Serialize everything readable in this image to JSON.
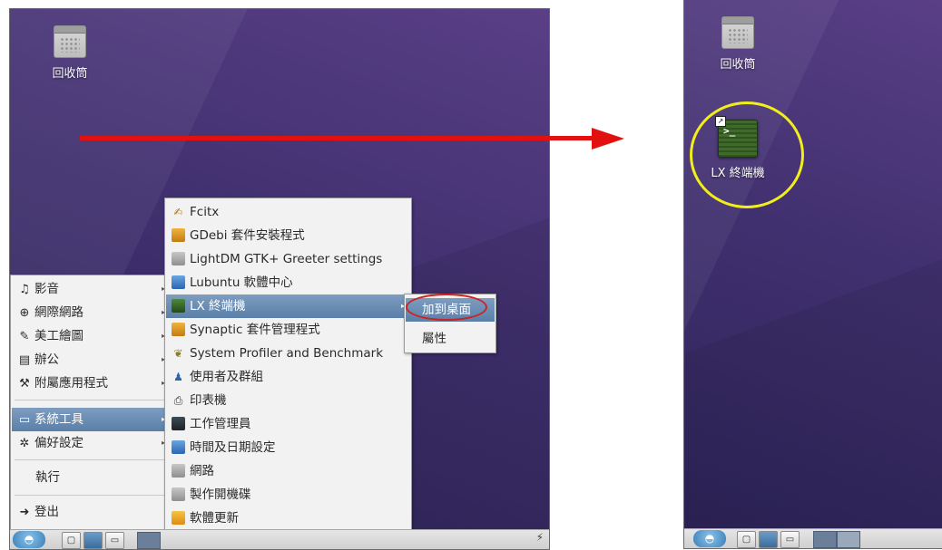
{
  "left_desktop": {
    "trash_label": "回收筒"
  },
  "right_desktop": {
    "trash_label": "回收筒",
    "terminal_label": "LX 終端機",
    "terminal_prompt": ">_"
  },
  "main_menu": {
    "items": [
      {
        "icon": "multimedia-icon",
        "label": "影音"
      },
      {
        "icon": "globe-icon",
        "label": "網際網路"
      },
      {
        "icon": "graphics-icon",
        "label": "美工繪圖"
      },
      {
        "icon": "office-icon",
        "label": "辦公"
      },
      {
        "icon": "accessories-icon",
        "label": "附屬應用程式"
      },
      {
        "icon": "monitor-icon",
        "label": "系統工具"
      },
      {
        "icon": "gear-icon",
        "label": "偏好設定"
      },
      {
        "icon": "",
        "label": "執行"
      },
      {
        "icon": "logout-icon",
        "label": "登出"
      }
    ],
    "selected": "系統工具"
  },
  "system_tools_menu": {
    "items": [
      {
        "icon": "fcitx-icon",
        "label": "Fcitx"
      },
      {
        "icon": "package-icon",
        "label": "GDebi 套件安裝程式"
      },
      {
        "icon": "settings-window-icon",
        "label": "LightDM GTK+ Greeter settings"
      },
      {
        "icon": "software-center-icon",
        "label": "Lubuntu 軟體中心"
      },
      {
        "icon": "terminal-icon",
        "label": "LX 終端機"
      },
      {
        "icon": "synaptic-icon",
        "label": "Synaptic 套件管理程式"
      },
      {
        "icon": "profiler-icon",
        "label": "System Profiler and Benchmark"
      },
      {
        "icon": "users-icon",
        "label": "使用者及群組"
      },
      {
        "icon": "printer-icon",
        "label": "印表機"
      },
      {
        "icon": "task-manager-icon",
        "label": "工作管理員"
      },
      {
        "icon": "clock-icon",
        "label": "時間及日期設定"
      },
      {
        "icon": "network-icon",
        "label": "網路"
      },
      {
        "icon": "usb-disk-icon",
        "label": "製作開機碟"
      },
      {
        "icon": "update-icon",
        "label": "軟體更新"
      }
    ],
    "selected": "LX 終端機"
  },
  "context_menu": {
    "items": [
      {
        "label": "加到桌面"
      },
      {
        "label": "屬性"
      }
    ],
    "selected": "加到桌面"
  },
  "colors": {
    "arrow": "#e31010",
    "highlight_circle": "#f1ee1b",
    "menu_selection": "#5b7fa8",
    "desktop_background": "#40306f"
  }
}
